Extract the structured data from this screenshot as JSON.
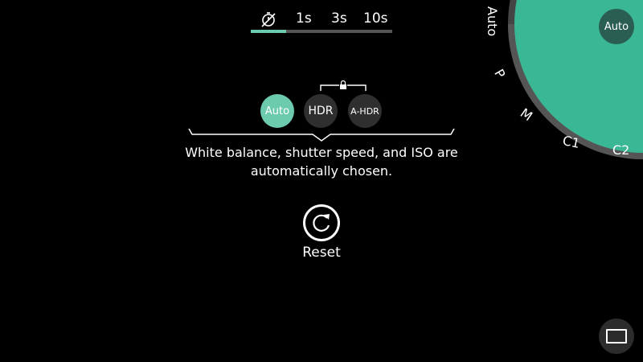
{
  "timer": {
    "options": [
      {
        "icon": "timer-off-icon"
      },
      {
        "label": "1s"
      },
      {
        "label": "3s"
      },
      {
        "label": "10s"
      }
    ],
    "selected_index": 0,
    "accent": "#6ccaae"
  },
  "hdr": {
    "modes": [
      "Auto",
      "HDR",
      "A-HDR"
    ],
    "selected": "Auto"
  },
  "description": "White balance, shutter speed, and ISO are automatically chosen.",
  "reset": {
    "label": "Reset",
    "icon": "reset-icon"
  },
  "dial": {
    "labels": [
      "Auto",
      "P",
      "M",
      "C1",
      "C2"
    ],
    "selected": "Auto",
    "accent": "#3ab795"
  },
  "view_toggle": {
    "icon": "view-rectangle-icon"
  }
}
